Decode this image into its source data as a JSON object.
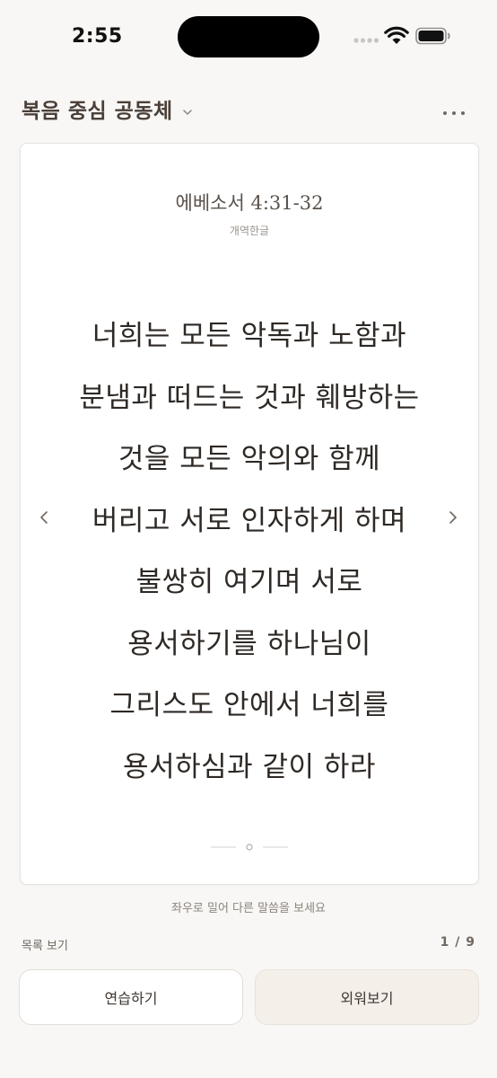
{
  "status_bar": {
    "time": "2:55"
  },
  "header": {
    "group_title": "복음 중심 공동체"
  },
  "card": {
    "reference": "에베소서 4:31-32",
    "version": "개역한글",
    "verse_lines": [
      "너희는 모든 악독과 노함과",
      "분냄과 떠드는 것과 훼방하는",
      "것을 모든 악의와 함께",
      "버리고 서로 인자하게 하며",
      "불쌍히 여기며 서로",
      "용서하기를 하나님이",
      "그리스도 안에서 너희를",
      "용서하심과 같이 하라"
    ]
  },
  "hint": "좌우로 밀어 다른 말씀을 보세요",
  "list_link": "목록 보기",
  "pagination": {
    "label": "1 / 9",
    "current": 1,
    "total": 9
  },
  "buttons": {
    "practice": "연습하기",
    "memorize": "외워보기"
  },
  "icons": {
    "signal": "cellular-signal-icon",
    "wifi": "wifi-icon",
    "battery": "battery-icon",
    "chevron": "chevron-down-icon",
    "more": "more-horizontal-icon",
    "prev": "chevron-left-icon",
    "next": "chevron-right-icon"
  },
  "colors": {
    "background": "#f8f7f5",
    "card": "#ffffff",
    "text_primary": "#2e2925",
    "title": "#4a3f38",
    "memorize_button": "#f4efe9"
  }
}
